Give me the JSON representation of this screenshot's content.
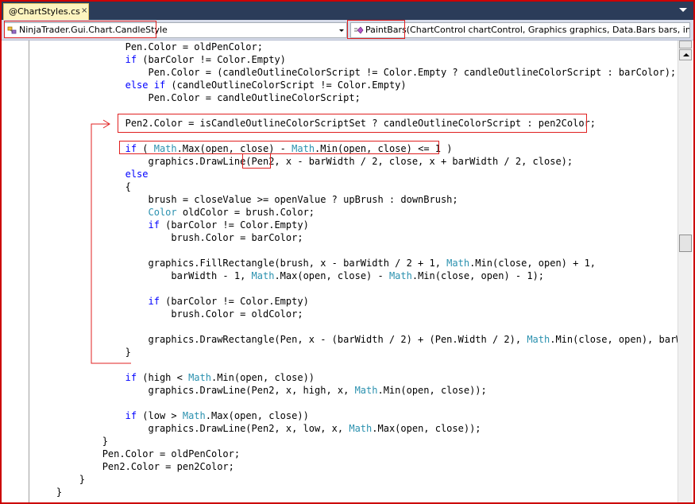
{
  "tab": {
    "title": "@ChartStyles.cs",
    "close_glyph": "×"
  },
  "navbar": {
    "type_combo": "NinjaTrader.Gui.Chart.CandleStyle",
    "member_combo": "PaintBars(ChartControl chartControl, Graphics graphics, Data.Bars bars, int panel)"
  },
  "colors": {
    "keyword": "#0000ff",
    "type": "#2b91af",
    "annotation": "#e02020",
    "tab_strip": "#2b3c59",
    "active_tab": "#fdf4bf"
  },
  "code": {
    "lines": [
      [
        {
          "t": "                Pen.Color = oldPenColor;"
        }
      ],
      [
        {
          "t": "                "
        },
        {
          "t": "if",
          "c": "kw"
        },
        {
          "t": " (barColor != Color.Empty)"
        }
      ],
      [
        {
          "t": "                    Pen.Color = (candleOutlineColorScript != Color.Empty ? candleOutlineColorScript : barColor);"
        }
      ],
      [
        {
          "t": "                "
        },
        {
          "t": "else",
          "c": "kw"
        },
        {
          "t": " "
        },
        {
          "t": "if",
          "c": "kw"
        },
        {
          "t": " (candleOutlineColorScript != Color.Empty)"
        }
      ],
      [
        {
          "t": "                    Pen.Color = candleOutlineColorScript;"
        }
      ],
      [
        {
          "t": ""
        }
      ],
      [
        {
          "t": "                Pen2.Color = isCandleOutlineColorScriptSet ? candleOutlineColorScript : pen2Color;"
        }
      ],
      [
        {
          "t": ""
        }
      ],
      [
        {
          "t": "                "
        },
        {
          "t": "if",
          "c": "kw"
        },
        {
          "t": " ( "
        },
        {
          "t": "Math",
          "c": "ty"
        },
        {
          "t": ".Max(open, close) - "
        },
        {
          "t": "Math",
          "c": "ty"
        },
        {
          "t": ".Min(open, close) <= 1 )"
        }
      ],
      [
        {
          "t": "                    graphics.DrawLine(Pen2, x - barWidth / 2, close, x + barWidth / 2, close);"
        }
      ],
      [
        {
          "t": "                "
        },
        {
          "t": "else",
          "c": "kw"
        }
      ],
      [
        {
          "t": "                {"
        }
      ],
      [
        {
          "t": "                    brush = closeValue >= openValue ? upBrush : downBrush;"
        }
      ],
      [
        {
          "t": "                    "
        },
        {
          "t": "Color",
          "c": "ty"
        },
        {
          "t": " oldColor = brush.Color;"
        }
      ],
      [
        {
          "t": "                    "
        },
        {
          "t": "if",
          "c": "kw"
        },
        {
          "t": " (barColor != Color.Empty)"
        }
      ],
      [
        {
          "t": "                        brush.Color = barColor;"
        }
      ],
      [
        {
          "t": ""
        }
      ],
      [
        {
          "t": "                    graphics.FillRectangle(brush, x - barWidth / 2 + 1, "
        },
        {
          "t": "Math",
          "c": "ty"
        },
        {
          "t": ".Min(close, open) + 1,"
        }
      ],
      [
        {
          "t": "                        barWidth - 1, "
        },
        {
          "t": "Math",
          "c": "ty"
        },
        {
          "t": ".Max(open, close) - "
        },
        {
          "t": "Math",
          "c": "ty"
        },
        {
          "t": ".Min(close, open) - 1);"
        }
      ],
      [
        {
          "t": ""
        }
      ],
      [
        {
          "t": "                    "
        },
        {
          "t": "if",
          "c": "kw"
        },
        {
          "t": " (barColor != Color.Empty)"
        }
      ],
      [
        {
          "t": "                        brush.Color = oldColor;"
        }
      ],
      [
        {
          "t": ""
        }
      ],
      [
        {
          "t": "                    graphics.DrawRectangle(Pen, x - (barWidth / 2) + (Pen.Width / 2), "
        },
        {
          "t": "Math",
          "c": "ty"
        },
        {
          "t": ".Min(close, open), barWidt"
        }
      ],
      [
        {
          "t": "                }"
        }
      ],
      [
        {
          "t": ""
        }
      ],
      [
        {
          "t": "                "
        },
        {
          "t": "if",
          "c": "kw"
        },
        {
          "t": " (high < "
        },
        {
          "t": "Math",
          "c": "ty"
        },
        {
          "t": ".Min(open, close))"
        }
      ],
      [
        {
          "t": "                    graphics.DrawLine(Pen2, x, high, x, "
        },
        {
          "t": "Math",
          "c": "ty"
        },
        {
          "t": ".Min(open, close));"
        }
      ],
      [
        {
          "t": ""
        }
      ],
      [
        {
          "t": "                "
        },
        {
          "t": "if",
          "c": "kw"
        },
        {
          "t": " (low > "
        },
        {
          "t": "Math",
          "c": "ty"
        },
        {
          "t": ".Max(open, close))"
        }
      ],
      [
        {
          "t": "                    graphics.DrawLine(Pen2, x, low, x, "
        },
        {
          "t": "Math",
          "c": "ty"
        },
        {
          "t": ".Max(open, close));"
        }
      ],
      [
        {
          "t": "            }"
        }
      ],
      [
        {
          "t": "            Pen.Color = oldPenColor;"
        }
      ],
      [
        {
          "t": "            Pen2.Color = pen2Color;"
        }
      ],
      [
        {
          "t": "        }"
        }
      ],
      [
        {
          "t": "    }"
        }
      ]
    ]
  }
}
